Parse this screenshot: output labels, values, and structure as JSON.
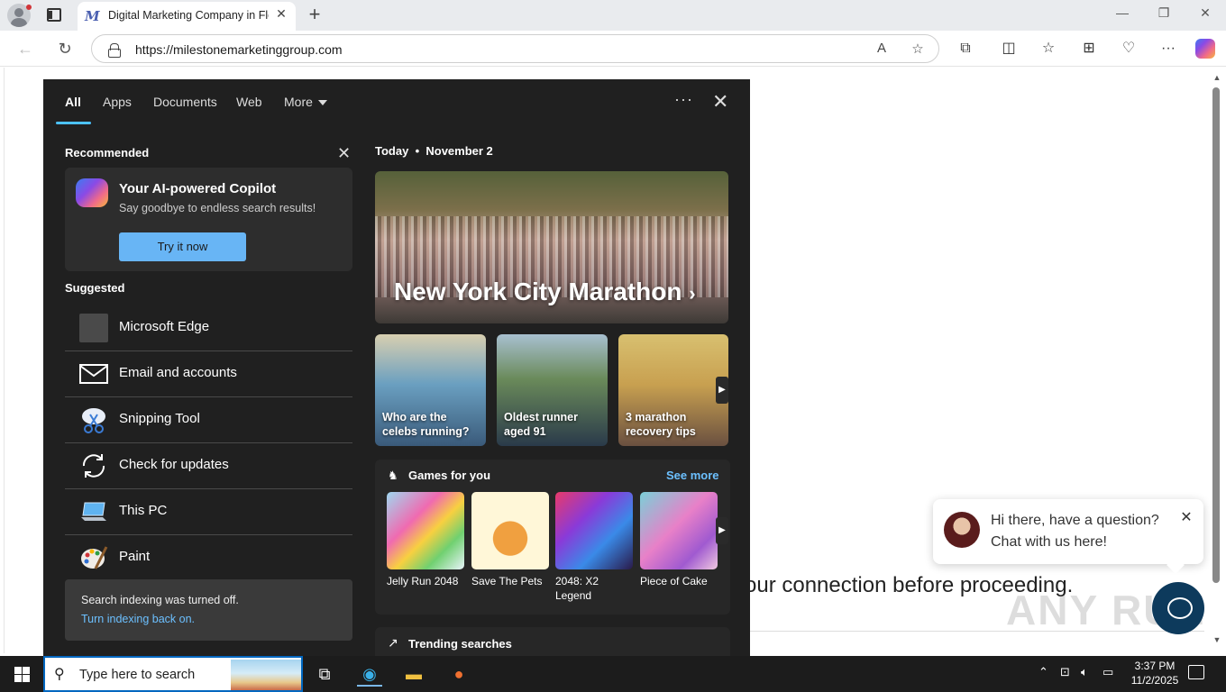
{
  "browser": {
    "tab_title": "Digital Marketing Company in Flo",
    "tab_favicon": "M",
    "url": "https://milestonemarketinggroup.com"
  },
  "page": {
    "partial_text": "our connection before proceeding.",
    "watermark": "ANY RUN"
  },
  "chat": {
    "message_line1": "Hi there, have a question?",
    "message_line2": "Chat with us here!"
  },
  "search_panel": {
    "tabs": [
      "All",
      "Apps",
      "Documents",
      "Web",
      "More"
    ],
    "recommended_title": "Recommended",
    "copilot": {
      "title": "Your AI-powered Copilot",
      "subtitle": "Say goodbye to endless search results!",
      "button": "Try it now"
    },
    "suggested_title": "Suggested",
    "suggested": [
      {
        "label": "Microsoft Edge",
        "icon": "edge-app-icon"
      },
      {
        "label": "Email and accounts",
        "icon": "mail-icon"
      },
      {
        "label": "Snipping Tool",
        "icon": "snipping-tool-icon"
      },
      {
        "label": "Check for updates",
        "icon": "refresh-icon"
      },
      {
        "label": "This PC",
        "icon": "computer-icon"
      },
      {
        "label": "Paint",
        "icon": "paint-palette-icon"
      }
    ],
    "indexing_notice": "Search indexing was turned off.",
    "indexing_link": "Turn indexing back on.",
    "today_label": "Today",
    "today_date": "November 2",
    "hero_title": "New York City Marathon",
    "cards": [
      {
        "caption": "Who are the celebs running?"
      },
      {
        "caption": "Oldest runner aged 91"
      },
      {
        "caption": "3 marathon recovery tips"
      }
    ],
    "games_title": "Games for you",
    "games_see_more": "See more",
    "games": [
      {
        "name": "Jelly Run 2048"
      },
      {
        "name": "Save The Pets"
      },
      {
        "name": "2048: X2 Legend"
      },
      {
        "name": "Piece of Cake"
      }
    ],
    "trending_title": "Trending searches"
  },
  "taskbar": {
    "search_placeholder": "Type here to search",
    "time": "3:37 PM",
    "date": "11/2/2025"
  },
  "colors": {
    "accent": "#0067c0",
    "link": "#6cc0ff",
    "copilot_button": "#68b5f5",
    "panel_bg": "#202020"
  }
}
